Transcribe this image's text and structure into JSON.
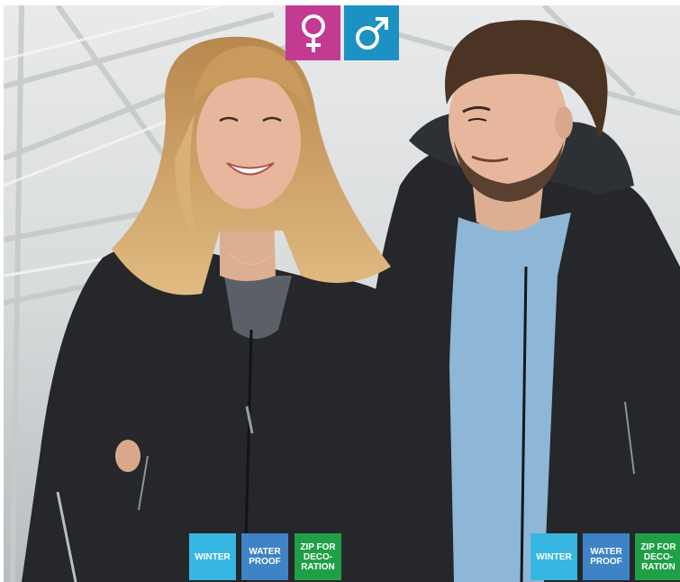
{
  "gender_icons": [
    {
      "name": "female-symbol-icon",
      "color": "#c23a92"
    },
    {
      "name": "male-symbol-icon",
      "color": "#1c91c3"
    }
  ],
  "badges_left": [
    {
      "label": "WINTER",
      "color": "#37b6e2"
    },
    {
      "label": "WATER\nPROOF",
      "color": "#3d83c6"
    },
    {
      "label": "ZIP FOR\nDECO-\nRATION",
      "color": "#1fa046"
    }
  ],
  "badges_right": [
    {
      "label": "WINTER",
      "color": "#37b6e2"
    },
    {
      "label": "WATER\nPROOF",
      "color": "#3d83c6"
    },
    {
      "label": "ZIP FOR\nDECO-\nRATION",
      "color": "#1fa046"
    }
  ],
  "colors": {
    "jacket": "#25272a",
    "tshirt_man": "#8eb6d6",
    "tshirt_woman": "#5b6068",
    "hair_woman": "#caa064",
    "hair_man": "#4b3423",
    "skin": "#e6b79c"
  }
}
